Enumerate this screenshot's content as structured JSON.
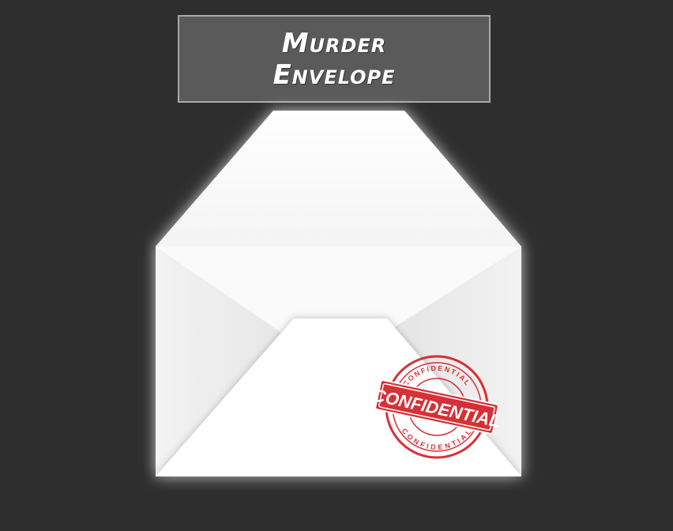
{
  "title": {
    "line1": "Murder",
    "line2": "Envelope"
  },
  "stamp": {
    "main_label": "CONFIDENTIAL",
    "ring_label_top": "CONFIDENTIAL",
    "ring_label_bottom": "CONFIDENTIAL",
    "color": "#d41f26"
  },
  "colors": {
    "background": "#2e2e2e",
    "title_box": "#5a5a5a",
    "title_border": "#a9a9a9",
    "envelope": "#ffffff"
  }
}
